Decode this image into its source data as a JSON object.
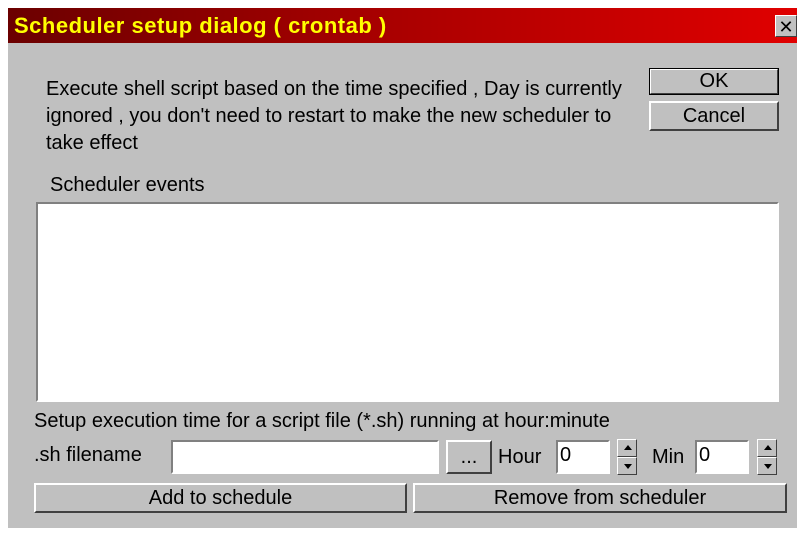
{
  "dialog": {
    "title": "Scheduler setup dialog ( crontab )",
    "close_glyph": "✕",
    "description": "Execute shell script based on the time specified , Day is currently ignored , you don't need to restart to make the new scheduler to take effect",
    "ok_label": "OK",
    "cancel_label": "Cancel",
    "events_label": "Scheduler events",
    "events": [],
    "setup_label": "Setup execution time for a script file (*.sh) running at hour:minute",
    "filename_label": ".sh filename",
    "filename_value": "",
    "browse_label": "...",
    "hour_label": "Hour",
    "hour_value": "0",
    "min_label": "Min",
    "min_value": "0",
    "add_label": "Add to schedule",
    "remove_label": "Remove from scheduler"
  },
  "colors": {
    "title_text": "#ffff00",
    "title_gradient_start": "#6b0000",
    "title_gradient_end": "#e00000",
    "face": "#c0c0c0"
  }
}
